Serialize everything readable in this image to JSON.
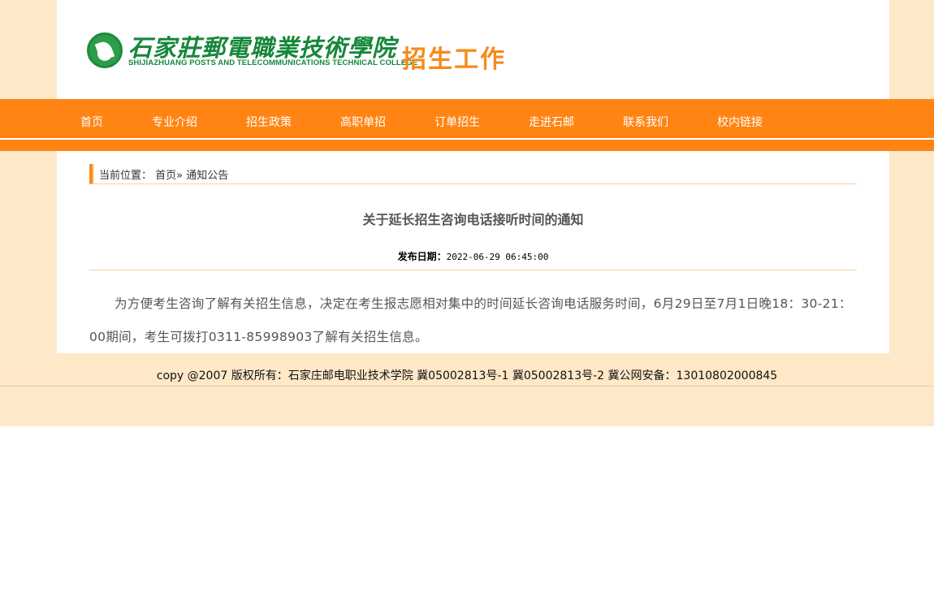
{
  "header": {
    "logo_cn": "石家莊郵電職業技術學院",
    "logo_en": "SHIJIAZHUANG POSTS AND TELECOMMUNICATIONS TECHNICAL COLLEGE",
    "site_title": "招生工作"
  },
  "nav": {
    "items": [
      {
        "label": "首页"
      },
      {
        "label": "专业介绍"
      },
      {
        "label": "招生政策"
      },
      {
        "label": "高职单招"
      },
      {
        "label": "订单招生"
      },
      {
        "label": "走进石邮"
      },
      {
        "label": "联系我们"
      },
      {
        "label": "校内链接"
      }
    ]
  },
  "breadcrumb": {
    "prefix": "当前位置：",
    "home": "首页",
    "separator": "»",
    "current": "通知公告"
  },
  "article": {
    "title": "关于延长招生咨询电话接听时间的通知",
    "date_label": "发布日期：",
    "date_value": "2022-06-29 06:45:00",
    "body": "为方便考生咨询了解有关招生信息，决定在考生报志愿相对集中的时间延长咨询电话服务时间，6月29日至7月1日晚18：30-21：00期间，考生可拨打0311-85998903了解有关招生信息。"
  },
  "footer": {
    "text": "copy @2007 版权所有：石家庄邮电职业技术学院 冀05002813号-1 冀05002813号-2 冀公网安备：13010802000845"
  },
  "colors": {
    "accent_orange": "#ff8414",
    "title_orange": "#f78a1b",
    "logo_green": "#16873a",
    "page_background": "#fde9c9"
  }
}
